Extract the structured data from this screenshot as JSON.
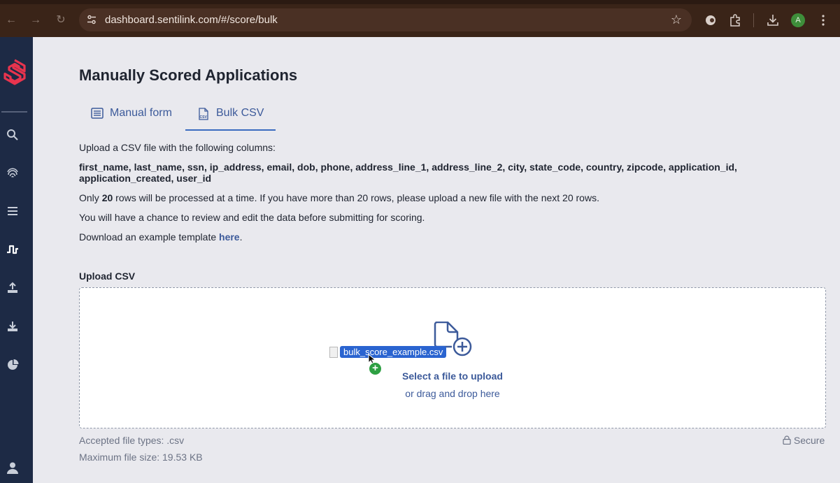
{
  "browser": {
    "url": "dashboard.sentilink.com/#/score/bulk",
    "avatar_initial": "A",
    "icons": [
      "back-icon",
      "forward-icon",
      "reload-icon",
      "site-settings-icon",
      "bookmark-star-icon",
      "extension-icon",
      "puzzle-icon",
      "download-icon",
      "menu-dots-icon"
    ]
  },
  "sidebar": {
    "icons": [
      "search-icon",
      "fingerprint-icon",
      "list-icon",
      "waveform-icon",
      "upload-icon",
      "download-icon",
      "pie-chart-icon",
      "user-icon"
    ]
  },
  "page": {
    "title": "Manually Scored Applications",
    "tabs": [
      {
        "label": "Manual form",
        "active": false
      },
      {
        "label": "Bulk CSV",
        "active": true
      }
    ],
    "intro": "Upload a CSV file with the following columns:",
    "columns": "first_name, last_name, ssn, ip_address, email, dob, phone, address_line_1, address_line_2, city, state_code, country, zipcode, application_id, application_created, user_id",
    "rows_prefix": "Only ",
    "rows_count": "20",
    "rows_suffix": " rows will be processed at a time. If you have more than 20 rows, please upload a new file with the next 20 rows.",
    "review_note": "You will have a chance to review and edit the data before submitting for scoring.",
    "template_prefix": "Download an example template ",
    "template_link": "here",
    "template_suffix": "."
  },
  "upload": {
    "label": "Upload CSV",
    "select_text": "Select a file to upload",
    "drag_text": "or drag and drop here",
    "dragged_file": "bulk_score_example.csv",
    "accepted": "Accepted file types: .csv",
    "max_size": "Maximum file size: 19.53 KB",
    "secure": "Secure"
  },
  "colors": {
    "accent": "#3c5a9a",
    "sidebar": "#1d2a45",
    "logo": "#e8344e",
    "chrome": "#3a2418"
  }
}
